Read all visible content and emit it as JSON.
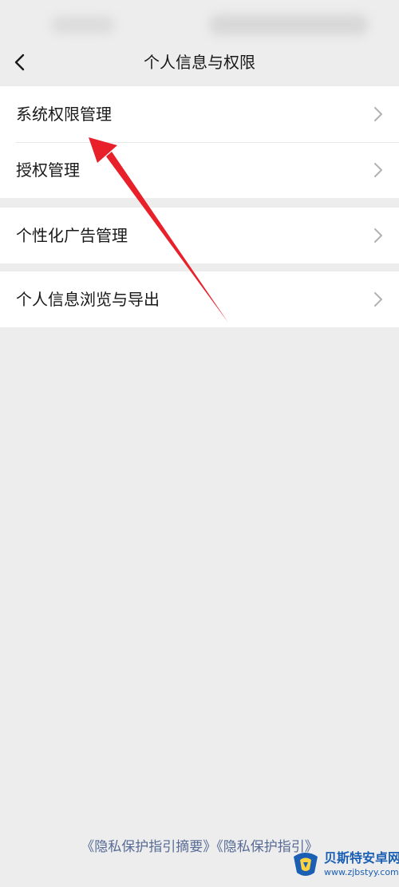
{
  "nav": {
    "title": "个人信息与权限",
    "back_icon": "chevron-left-icon"
  },
  "menu_groups": [
    {
      "items": [
        {
          "label": "系统权限管理",
          "icon": "chevron-right-icon"
        },
        {
          "label": "授权管理",
          "icon": "chevron-right-icon"
        }
      ]
    },
    {
      "items": [
        {
          "label": "个性化广告管理",
          "icon": "chevron-right-icon"
        }
      ]
    },
    {
      "items": [
        {
          "label": "个人信息浏览与导出",
          "icon": "chevron-right-icon"
        }
      ]
    }
  ],
  "footer": {
    "link_1": "《隐私保护指引摘要》",
    "link_2": "《隐私保护指引》"
  },
  "annotation": {
    "type": "red-arrow",
    "target": "系统权限管理",
    "color": "#e8202a"
  },
  "watermark": {
    "name": "贝斯特安卓网",
    "url": "www.zjbstyy.com",
    "color": "#1a5fb4"
  }
}
